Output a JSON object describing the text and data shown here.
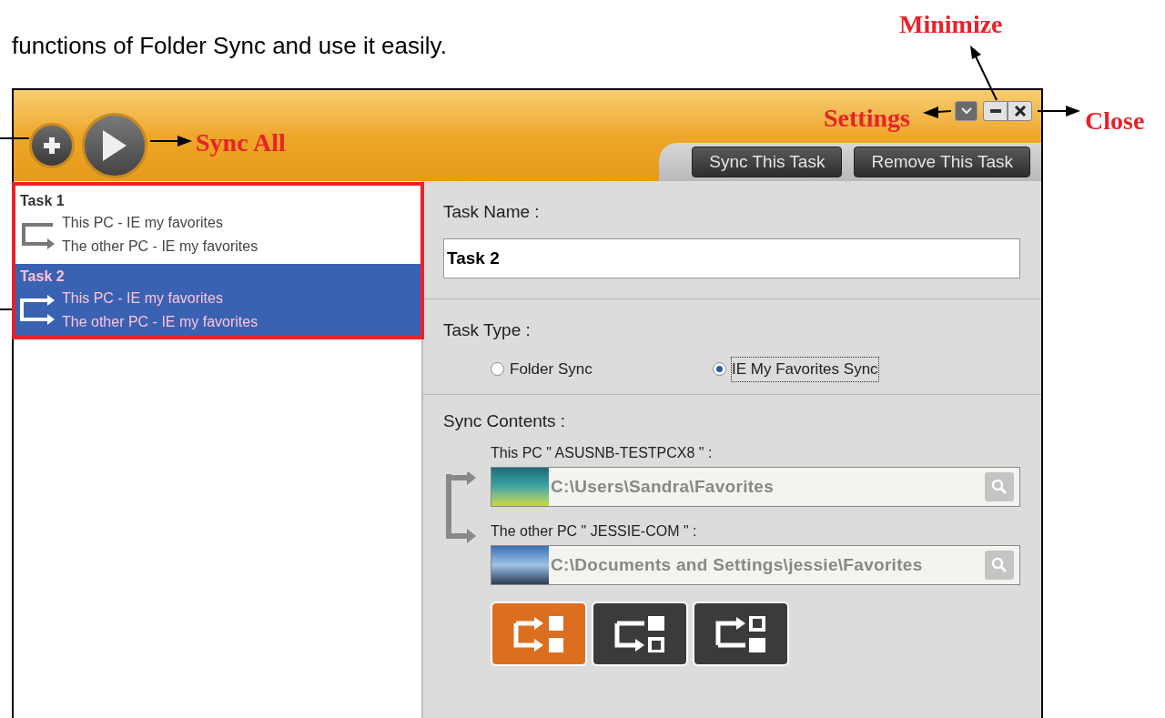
{
  "caption": "functions of Folder Sync and use it easily.",
  "annotations": [
    {
      "kind": "minimize",
      "text": "Minimize"
    },
    {
      "kind": "settings",
      "text": "Settings"
    },
    {
      "kind": "close",
      "text": "Close"
    },
    {
      "kind": "sync-all",
      "text": "Sync All"
    }
  ],
  "toolbar": {
    "buttons": [
      "Sync This Task",
      "Remove This Task"
    ]
  },
  "tasks": [
    {
      "name": "Task 1",
      "source": "This PC - IE my favorites",
      "target": "The other PC - IE my favorites",
      "selected": false
    },
    {
      "name": "Task 2",
      "source": "This PC - IE my favorites",
      "target": "The other PC - IE my favorites",
      "selected": true
    }
  ],
  "task_name": {
    "label": "Task Name :",
    "value": "Task 2"
  },
  "task_type": {
    "label": "Task Type :",
    "options": [
      {
        "label": "Folder Sync",
        "selected": false
      },
      {
        "label": "IE My Favorites Sync",
        "selected": true
      }
    ]
  },
  "sync_contents": {
    "label": "Sync Contents :",
    "folders": [
      {
        "label": "This PC \" ASUSNB-TESTPCX8 \" :",
        "path": "C:\\Users\\Sandra\\Favorites"
      },
      {
        "label": "The other PC \" JESSIE-COM \" :",
        "path": "C:\\Documents and Settings\\jessie\\Favorites"
      }
    ],
    "modes": [
      {
        "kind": "two-way",
        "selected": true
      },
      {
        "kind": "to-other",
        "selected": false
      },
      {
        "kind": "to-this",
        "selected": false
      }
    ]
  }
}
